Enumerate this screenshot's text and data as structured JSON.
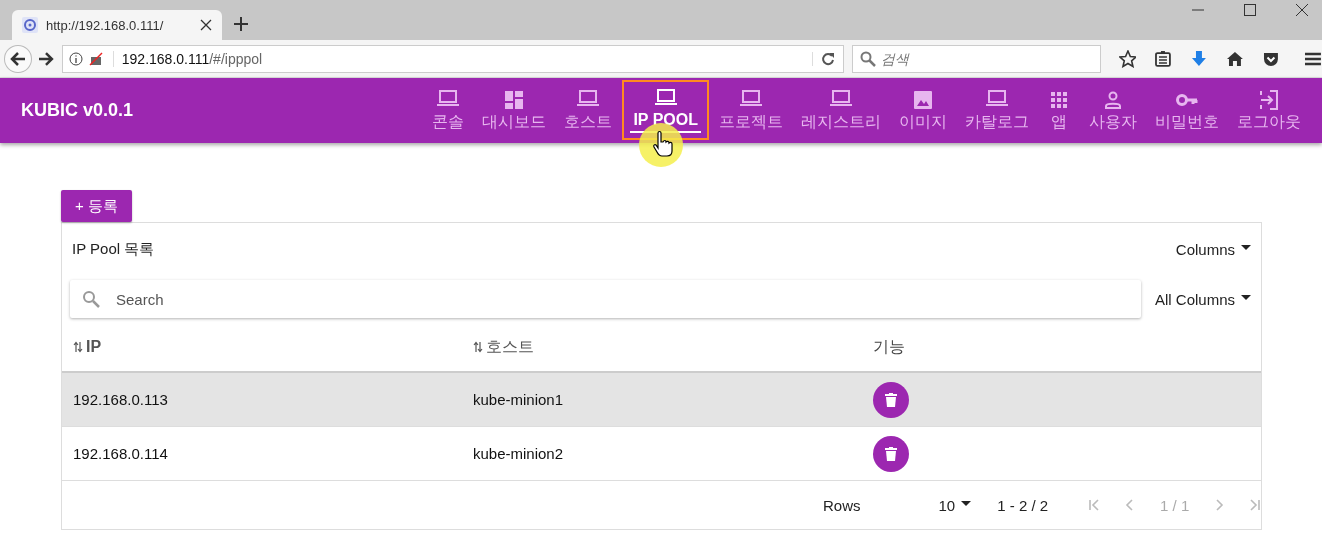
{
  "browser": {
    "tab_title": "http://192.168.0.111/",
    "url_host": "192.168.0.111",
    "url_path": "/#/ipppol",
    "search_placeholder": "검색"
  },
  "app": {
    "title": "KUBIC v0.0.1",
    "nav": [
      {
        "label": "콘솔",
        "kind": "laptop",
        "selected": false
      },
      {
        "label": "대시보드",
        "kind": "dashboard",
        "selected": false
      },
      {
        "label": "호스트",
        "kind": "laptop",
        "selected": false
      },
      {
        "label": "IP POOL",
        "kind": "laptop",
        "selected": true
      },
      {
        "label": "프로젝트",
        "kind": "laptop",
        "selected": false
      },
      {
        "label": "레지스트리",
        "kind": "laptop",
        "selected": false
      },
      {
        "label": "이미지",
        "kind": "image",
        "selected": false
      },
      {
        "label": "카탈로그",
        "kind": "laptop",
        "selected": false
      },
      {
        "label": "앱",
        "kind": "apps",
        "selected": false
      },
      {
        "label": "사용자",
        "kind": "person",
        "selected": false
      },
      {
        "label": "비밀번호",
        "kind": "key",
        "selected": false
      },
      {
        "label": "로그아웃",
        "kind": "logout",
        "selected": false
      }
    ]
  },
  "register_button": "+ 등록",
  "table": {
    "title": "IP Pool 목록",
    "columns_menu": "Columns",
    "search_placeholder": "Search",
    "search_scope": "All Columns",
    "columns": [
      {
        "label": "IP",
        "sortable": true
      },
      {
        "label": "호스트",
        "sortable": true
      },
      {
        "label": "기능",
        "sortable": false
      }
    ],
    "rows": [
      {
        "ip": "192.168.0.113",
        "host": "kube-minion1",
        "selected": true
      },
      {
        "ip": "192.168.0.114",
        "host": "kube-minion2",
        "selected": false
      }
    ],
    "footer": {
      "rows_label": "Rows",
      "rows_per_page": "10",
      "range": "1 - 2 / 2",
      "page": "1 / 1"
    }
  }
}
